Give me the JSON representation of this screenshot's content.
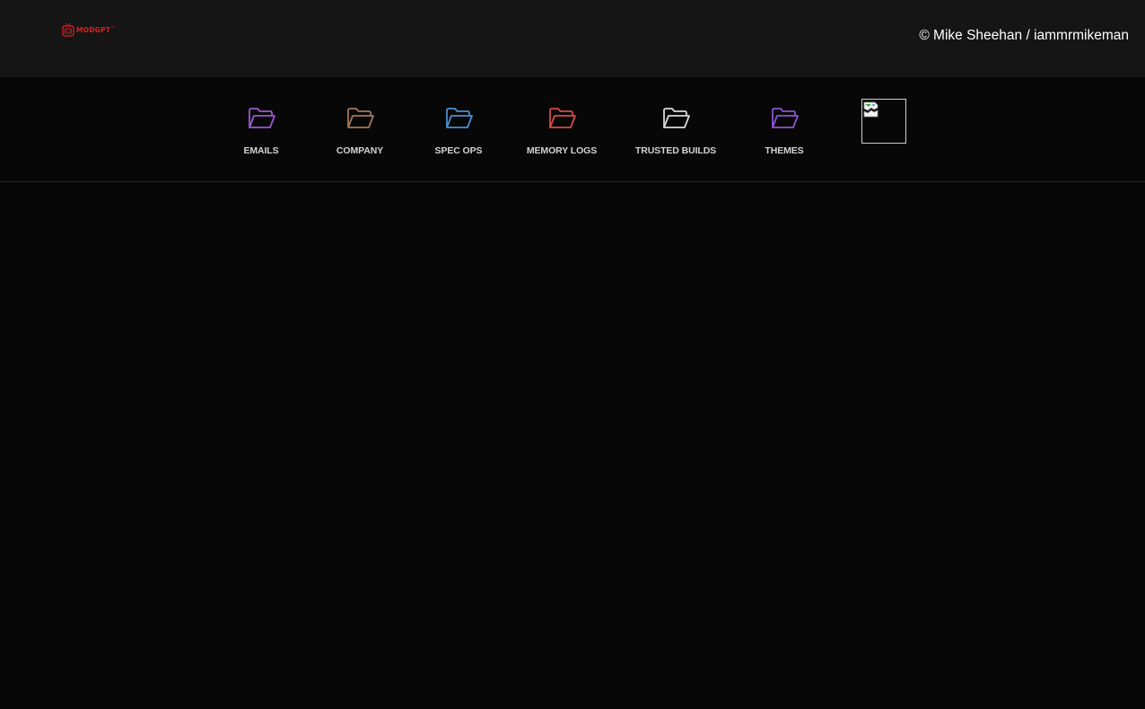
{
  "header": {
    "logo_text": "MODGPT",
    "logo_mark": "™",
    "copyright": "© Mike Sheehan / iammrmikeman"
  },
  "nav": {
    "folders": [
      {
        "label": "EMAILS",
        "icon": "folder-icon",
        "color": "#9b59d0"
      },
      {
        "label": "COMPANY",
        "icon": "folder-icon",
        "color": "#a0785a"
      },
      {
        "label": "SPEC OPS",
        "icon": "folder-icon",
        "color": "#4a8fcf"
      },
      {
        "label": "MEMORY LOGS",
        "icon": "folder-icon",
        "color": "#d24b45"
      },
      {
        "label": "TRUSTED BUILDS",
        "icon": "folder-icon",
        "color": "#d8d8d8"
      },
      {
        "label": "THEMES",
        "icon": "folder-icon",
        "color": "#8a55d0"
      }
    ],
    "image_placeholder_icon": "broken-image-icon"
  },
  "colors": {
    "background": "#070707",
    "topbar": "#151515",
    "brand_red": "#e01e1e",
    "label_text": "#d2d2d2"
  }
}
